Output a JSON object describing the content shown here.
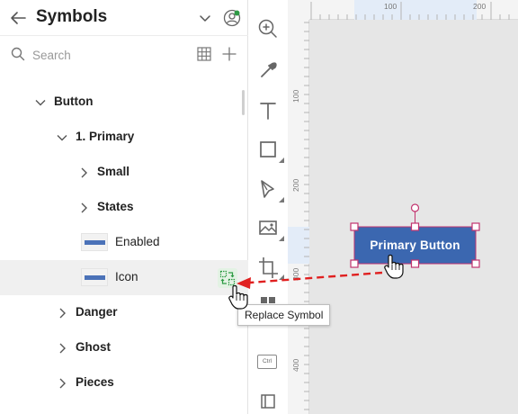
{
  "panel": {
    "title": "Symbols",
    "search_placeholder": "Search"
  },
  "tree": [
    {
      "label": "Button",
      "level": 0,
      "expanded": true
    },
    {
      "label": "1. Primary",
      "level": 1,
      "expanded": true
    },
    {
      "label": "Small",
      "level": 2,
      "expanded": false
    },
    {
      "label": "States",
      "level": 2,
      "expanded": false
    },
    {
      "label": "Enabled",
      "level": 2,
      "thumbnail": true
    },
    {
      "label": "Icon",
      "level": 2,
      "thumbnail": true,
      "selected": true
    },
    {
      "label": "Danger",
      "level": 1,
      "expanded": false
    },
    {
      "label": "Ghost",
      "level": 1,
      "expanded": false
    },
    {
      "label": "Pieces",
      "level": 1,
      "expanded": false
    }
  ],
  "tooltip": "Replace Symbol",
  "canvas": {
    "button_label": "Primary Button",
    "button_color": "#3b67b0"
  },
  "rulers": {
    "top": [
      "100",
      "200"
    ],
    "left": [
      "100",
      "200",
      "300",
      "400"
    ]
  },
  "toolbar": {
    "tools": [
      "zoom-tool",
      "eyedropper-tool",
      "text-tool",
      "rectangle-tool",
      "pen-tool",
      "image-tool",
      "artboard-tool",
      "components-tool"
    ],
    "ctrl_label": "Ctrl"
  },
  "colors": {
    "accent_green": "#2e9b45",
    "arrow_red": "#e02020",
    "handle_pink": "#c2336e"
  }
}
